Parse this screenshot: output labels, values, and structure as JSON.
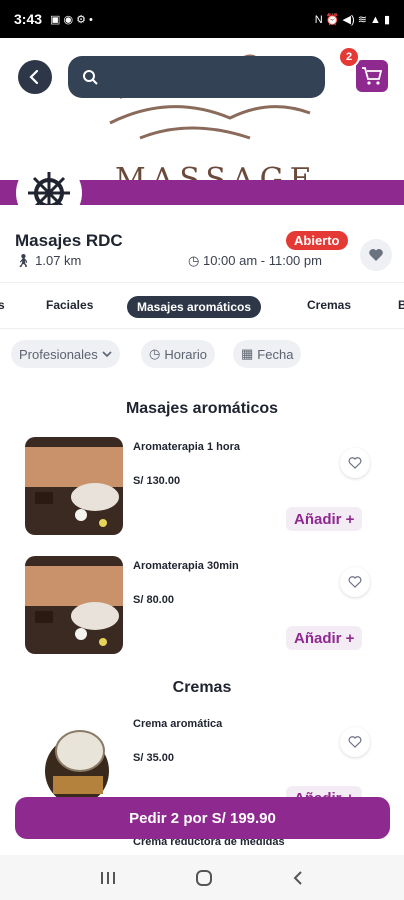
{
  "status_bar": {
    "time": "3:43"
  },
  "search": {
    "placeholder": ""
  },
  "cart": {
    "count": "2"
  },
  "hero": {
    "text": "MASSAGE"
  },
  "store": {
    "name": "Masajes RDC",
    "distance": "1.07 km",
    "status": "Abierto",
    "hours": "10:00 am - 11:00 pm"
  },
  "tabs": [
    "s",
    "Faciales",
    "Masajes aromáticos",
    "Cremas",
    "B"
  ],
  "filters": [
    "Profesionales",
    "Horario",
    "Fecha"
  ],
  "sections": [
    {
      "title": "Masajes aromáticos",
      "products": [
        {
          "name": "Aromaterapia 1 hora",
          "price": "S/ 130.00",
          "add_label": "Añadir +"
        },
        {
          "name": "Aromaterapia 30min",
          "price": "S/ 80.00",
          "add_label": "Añadir +"
        }
      ]
    },
    {
      "title": "Cremas",
      "products": [
        {
          "name": "Crema aromática",
          "price": "S/ 35.00",
          "add_label": "Añadir +"
        },
        {
          "name": "Crema reductora de medidas",
          "price": "",
          "add_label": ""
        }
      ]
    }
  ],
  "order_button": "Pedir 2 por S/ 199.90",
  "colors": {
    "brand": "#8e2a8f",
    "dark": "#2d3748",
    "open": "#e53935"
  }
}
